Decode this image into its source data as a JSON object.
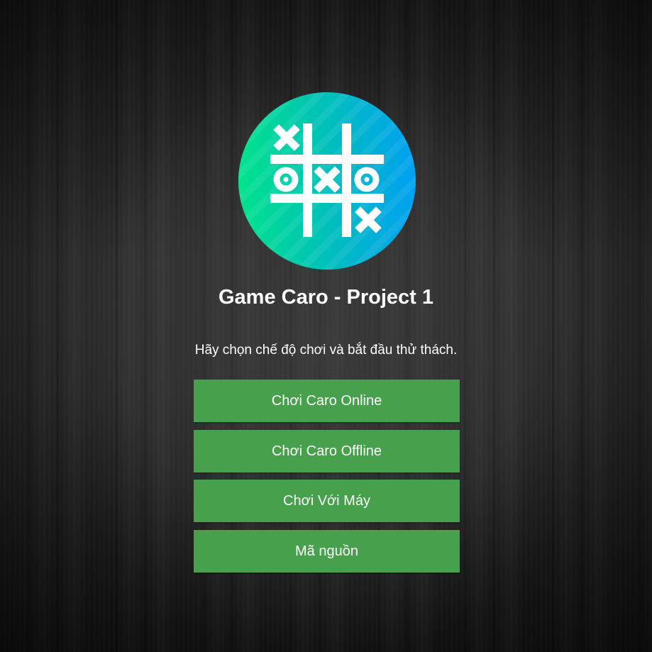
{
  "app": {
    "title": "Game Caro - Project 1",
    "subtitle": "Hãy chọn chế độ chơi và bắt đầu thử thách.",
    "logo_icon": "tic-tac-toe-icon"
  },
  "menu": {
    "buttons": [
      {
        "label": "Chơi Caro Online"
      },
      {
        "label": "Chơi Caro Offline"
      },
      {
        "label": "Chơi Với Máy"
      },
      {
        "label": "Mã nguồn"
      }
    ]
  },
  "colors": {
    "button_bg": "#47a04b",
    "logo_gradient_start": "#00e38c",
    "logo_gradient_end": "#00a0f2",
    "text": "#ffffff"
  }
}
